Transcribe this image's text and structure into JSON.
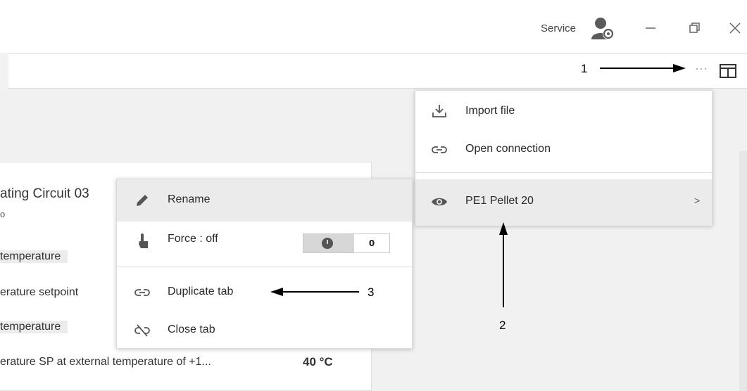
{
  "titlebar": {
    "account_label": "Service",
    "icons": [
      "account-settings-icon",
      "minimize-icon",
      "restore-icon",
      "close-icon"
    ]
  },
  "toolbar": {
    "icons": [
      "more-options-icon",
      "layout-panel-icon"
    ]
  },
  "card": {
    "title": "ating Circuit 03",
    "subtitle": "o",
    "rows": [
      {
        "label": "temperature"
      },
      {
        "label": "erature setpoint"
      },
      {
        "label": "temperature"
      },
      {
        "label": "erature SP at external temperature of +1...",
        "value": "40 °C"
      }
    ]
  },
  "context_menu": {
    "items": [
      {
        "label": "Rename",
        "icon": "pencil-icon"
      },
      {
        "label": "Force :  off",
        "icon": "hand-pointer-icon"
      },
      {
        "label": "Duplicate tab",
        "icon": "link-icon"
      },
      {
        "label": "Close tab",
        "icon": "unlink-icon"
      }
    ],
    "toggle": {
      "value": "0"
    }
  },
  "top_menu": {
    "items": [
      {
        "label": "Import file",
        "icon": "download-tray-icon"
      },
      {
        "label": "Open connection",
        "icon": "link-icon"
      },
      {
        "label": "PE1 Pellet 20",
        "icon": "eye-icon"
      }
    ],
    "submenu_indicator": ">"
  },
  "annotations": {
    "one": "1",
    "two": "2",
    "three": "3"
  },
  "colors": {
    "background": "#f2f2f2",
    "menu_highlight": "#ebebeb",
    "text": "#2a2a2a"
  }
}
